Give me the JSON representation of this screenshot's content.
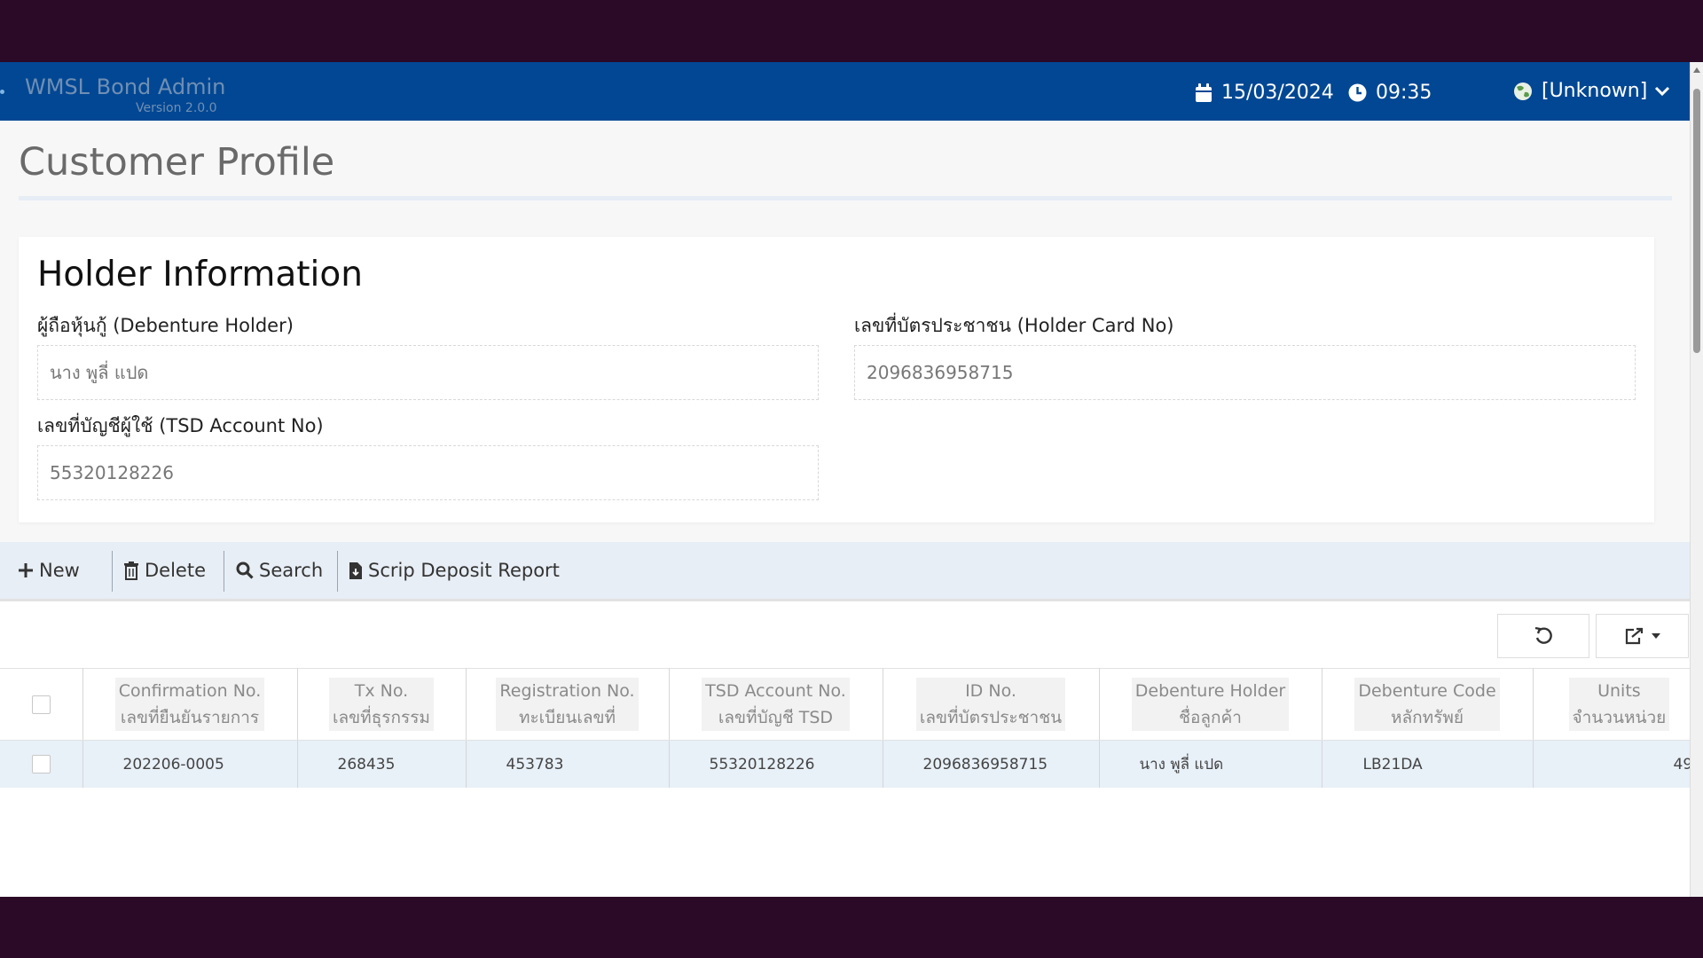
{
  "app": {
    "title": "WMSL Bond Admin",
    "version": "Version 2.0.0",
    "date": "15/03/2024",
    "time": "09:35",
    "user": "[Unknown]",
    "header_color": "#024793"
  },
  "page": {
    "title": "Customer Profile"
  },
  "holder": {
    "section_title": "Holder Information",
    "debenture_holder_label": "ผู้ถือหุ้นกู้ (Debenture Holder)",
    "debenture_holder_value": "นาง พูลี่ แปด",
    "holder_card_label": "เลขที่บัตรประชาชน (Holder Card No)",
    "holder_card_value": "2096836958715",
    "tsd_account_label": "เลขที่บัญชีผู้ใช้ (TSD Account No)",
    "tsd_account_value": "55320128226"
  },
  "toolbar": {
    "new_label": "New",
    "delete_label": "Delete",
    "search_label": "Search",
    "report_label": "Scrip Deposit Report"
  },
  "table": {
    "headers": [
      {
        "en": "Confirmation No.",
        "th": "เลขที่ยืนยันรายการ"
      },
      {
        "en": "Tx No.",
        "th": "เลขที่ธุรกรรม"
      },
      {
        "en": "Registration No.",
        "th": "ทะเบียนเลขที่"
      },
      {
        "en": "TSD Account No.",
        "th": "เลขที่บัญชี TSD"
      },
      {
        "en": "ID No.",
        "th": "เลขที่บัตรประชาชน"
      },
      {
        "en": "Debenture Holder",
        "th": "ชื่อลูกค้า"
      },
      {
        "en": "Debenture Code",
        "th": "หลักทรัพย์"
      },
      {
        "en": "Units",
        "th": "จำนวนหน่วย"
      }
    ],
    "rows": [
      {
        "confirmation_no": "202206-0005",
        "tx_no": "268435",
        "registration_no": "453783",
        "tsd_account_no": "55320128226",
        "id_no": "2096836958715",
        "debenture_holder": "นาง พูลี่ แปด",
        "debenture_code": "LB21DA",
        "units": "49"
      }
    ]
  }
}
